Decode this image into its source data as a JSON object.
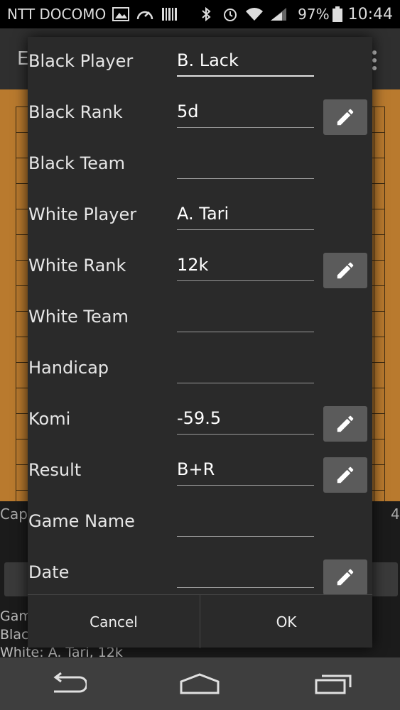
{
  "status_bar": {
    "carrier": "NTT DOCOMO",
    "battery": "97%",
    "time": "10:44"
  },
  "background": {
    "title_fragment": "E",
    "captured_fragment": "Cap",
    "captured_number": "4",
    "info_lines": [
      "Gam",
      "Blac",
      "White: A. Tari, 12k"
    ]
  },
  "dialog": {
    "fields": [
      {
        "label": "Black Player",
        "value": "B. Lack",
        "has_edit": false
      },
      {
        "label": "Black Rank",
        "value": "5d",
        "has_edit": true
      },
      {
        "label": "Black Team",
        "value": "",
        "has_edit": false
      },
      {
        "label": "White Player",
        "value": "A. Tari",
        "has_edit": false
      },
      {
        "label": "White Rank",
        "value": "12k",
        "has_edit": true
      },
      {
        "label": "White Team",
        "value": "",
        "has_edit": false
      },
      {
        "label": "Handicap",
        "value": "",
        "has_edit": false
      },
      {
        "label": "Komi",
        "value": "-59.5",
        "has_edit": true
      },
      {
        "label": "Result",
        "value": "B+R",
        "has_edit": true
      },
      {
        "label": "Game Name",
        "value": "",
        "has_edit": false
      },
      {
        "label": "Date",
        "value": "",
        "has_edit": true
      }
    ],
    "cancel_label": "Cancel",
    "ok_label": "OK"
  },
  "icons": {
    "edit": "pencil-icon",
    "back": "back-arrow-icon",
    "home": "home-icon",
    "recents": "recent-apps-icon"
  },
  "colors": {
    "dialog_bg": "#2a2a2a",
    "board": "#b97a2e",
    "edit_button": "#5b5b5b"
  }
}
